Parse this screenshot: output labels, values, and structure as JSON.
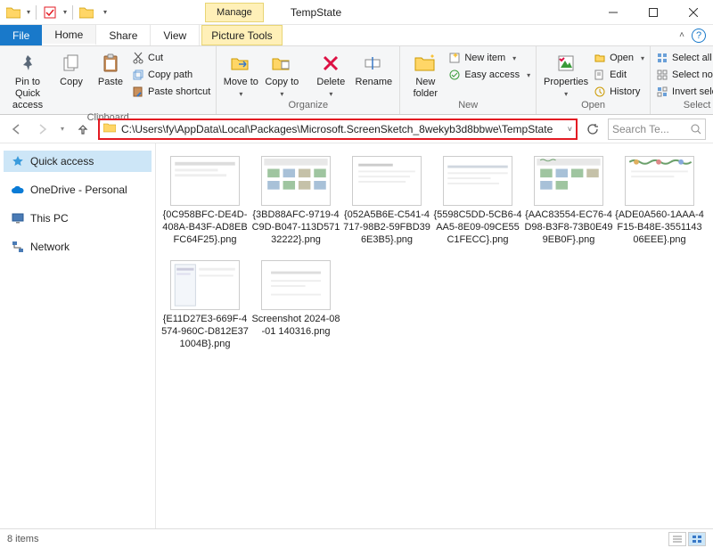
{
  "window": {
    "title": "TempState",
    "manage_label": "Manage"
  },
  "tabs": {
    "file": "File",
    "home": "Home",
    "share": "Share",
    "view": "View",
    "picture_tools": "Picture Tools"
  },
  "ribbon": {
    "clipboard": {
      "label": "Clipboard",
      "pin": "Pin to Quick access",
      "copy": "Copy",
      "paste": "Paste",
      "cut": "Cut",
      "copy_path": "Copy path",
      "paste_shortcut": "Paste shortcut"
    },
    "organize": {
      "label": "Organize",
      "move_to": "Move to",
      "copy_to": "Copy to",
      "delete": "Delete",
      "rename": "Rename"
    },
    "new": {
      "label": "New",
      "new_folder": "New folder",
      "new_item": "New item",
      "easy_access": "Easy access"
    },
    "open": {
      "label": "Open",
      "properties": "Properties",
      "open_btn": "Open",
      "edit": "Edit",
      "history": "History"
    },
    "select": {
      "label": "Select",
      "select_all": "Select all",
      "select_none": "Select none",
      "invert": "Invert selection"
    }
  },
  "address": {
    "path": "C:\\Users\\fy\\AppData\\Local\\Packages\\Microsoft.ScreenSketch_8wekyb3d8bbwe\\TempState"
  },
  "search": {
    "placeholder": "Search Te..."
  },
  "sidebar": {
    "items": [
      {
        "label": "Quick access",
        "icon": "star",
        "active": true
      },
      {
        "label": "OneDrive - Personal",
        "icon": "cloud",
        "active": false
      },
      {
        "label": "This PC",
        "icon": "pc",
        "active": false
      },
      {
        "label": "Network",
        "icon": "network",
        "active": false
      }
    ]
  },
  "files": [
    {
      "name": "{0C958BFC-DE4D-408A-B43F-AD8EBFC64F25}.png"
    },
    {
      "name": "{3BD88AFC-9719-4C9D-B047-113D57132222}.png"
    },
    {
      "name": "{052A5B6E-C541-4717-98B2-59FBD396E3B5}.png"
    },
    {
      "name": "{5598C5DD-5CB6-4AA5-8E09-09CE55C1FECC}.png"
    },
    {
      "name": "{AAC83554-EC76-4D98-B3F8-73B0E499EB0F}.png"
    },
    {
      "name": "{ADE0A560-1AAA-4F15-B48E-355114306EEE}.png"
    },
    {
      "name": "{E11D27E3-669F-4574-960C-D812E371004B}.png"
    },
    {
      "name": "Screenshot 2024-08-01 140316.png"
    }
  ],
  "status": {
    "count": "8 items"
  }
}
